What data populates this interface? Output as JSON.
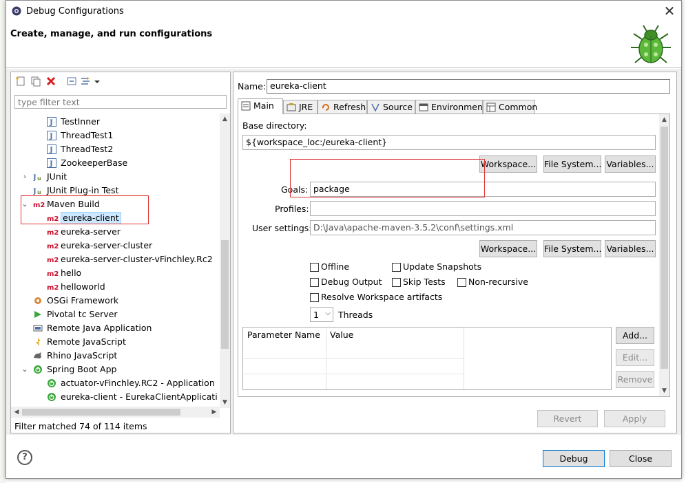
{
  "window": {
    "title": "Debug Configurations",
    "close_glyph": "✕"
  },
  "header": {
    "heading": "Create, manage, and run configurations"
  },
  "left": {
    "filter_placeholder": "type filter text",
    "tree": [
      {
        "label": "TestInner",
        "icon": "junit-class-icon"
      },
      {
        "label": "ThreadTest1",
        "icon": "junit-class-icon"
      },
      {
        "label": "ThreadTest2",
        "icon": "junit-class-icon"
      },
      {
        "label": "ZookeeperBase",
        "icon": "junit-class-icon"
      },
      {
        "label": "JUnit",
        "icon": "junit-icon",
        "expander": "›"
      },
      {
        "label": "JUnit Plug-in Test",
        "icon": "junit-plugin-icon"
      },
      {
        "label": "Maven Build",
        "icon": "maven-icon",
        "expander": "⌄"
      },
      {
        "label": "eureka-client",
        "icon": "maven-icon"
      },
      {
        "label": "eureka-server",
        "icon": "maven-icon"
      },
      {
        "label": "eureka-server-cluster",
        "icon": "maven-icon"
      },
      {
        "label": "eureka-server-cluster-vFinchley.Rc2",
        "icon": "maven-icon"
      },
      {
        "label": "hello",
        "icon": "maven-icon"
      },
      {
        "label": "helloworld",
        "icon": "maven-icon"
      },
      {
        "label": "OSGi Framework",
        "icon": "osgi-icon"
      },
      {
        "label": "Pivotal tc Server",
        "icon": "tc-server-icon"
      },
      {
        "label": "Remote Java Application",
        "icon": "remote-java-icon"
      },
      {
        "label": "Remote JavaScript",
        "icon": "remote-js-icon"
      },
      {
        "label": "Rhino JavaScript",
        "icon": "rhino-icon"
      },
      {
        "label": "Spring Boot App",
        "icon": "spring-boot-icon",
        "expander": "⌄"
      },
      {
        "label": "actuator-vFinchley.RC2 - Application",
        "icon": "spring-boot-icon"
      },
      {
        "label": "eureka-client - EurekaClientApplication",
        "icon": "spring-boot-icon"
      }
    ],
    "maven_badge": "m2",
    "status": "Filter matched 74 of 114 items"
  },
  "right": {
    "name_label": "Name:",
    "name_value": "eureka-client",
    "tabs": [
      {
        "label": "Main",
        "icon": "main-tab-icon"
      },
      {
        "label": "JRE",
        "icon": "jre-icon"
      },
      {
        "label": "Refresh",
        "icon": "refresh-icon"
      },
      {
        "label": "Source",
        "icon": "source-icon"
      },
      {
        "label": "Environment",
        "icon": "environment-icon"
      },
      {
        "label": "Common",
        "icon": "common-icon"
      }
    ],
    "base_dir_label": "Base directory:",
    "base_dir_value": "${workspace_loc:/eureka-client}",
    "workspace_btn": "Workspace...",
    "filesystem_btn": "File System...",
    "variables_btn": "Variables...",
    "goals_label": "Goals:",
    "goals_value": "package",
    "profiles_label": "Profiles:",
    "profiles_value": "",
    "user_settings_label": "User settings:",
    "user_settings_value": "D:\\Java\\apache-maven-3.5.2\\conf\\settings.xml",
    "checkboxes": {
      "offline": "Offline",
      "update_snapshots": "Update Snapshots",
      "debug_output": "Debug Output",
      "skip_tests": "Skip Tests",
      "non_recursive": "Non-recursive",
      "resolve_workspace": "Resolve Workspace artifacts"
    },
    "threads_value": "1",
    "threads_label": "Threads",
    "param_headers": [
      "Parameter Name",
      "Value"
    ],
    "add_btn": "Add...",
    "edit_btn": "Edit...",
    "remove_btn": "Remove",
    "revert_btn": "Revert",
    "apply_btn": "Apply"
  },
  "footer": {
    "help": "?",
    "debug_btn": "Debug",
    "close_btn": "Close"
  },
  "colors": {
    "selection": "#cce8ff",
    "annotation_red": "#e03030",
    "maven_red": "#c8102e",
    "spring_green": "#3aa63a"
  }
}
